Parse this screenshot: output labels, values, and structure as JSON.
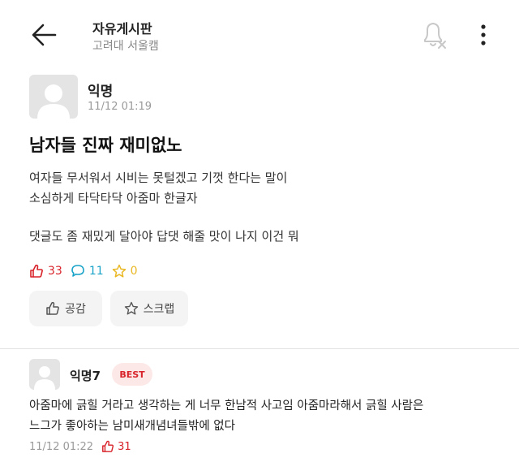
{
  "header": {
    "title": "자유게시판",
    "subtitle": "고려대 서울캠",
    "back_icon": "arrow-left-icon",
    "bell_icon": "bell-off-icon",
    "more_icon": "more-vertical-icon"
  },
  "post": {
    "author": "익명",
    "time": "11/12 01:19",
    "title": "남자들 진짜 재미없노",
    "body_lines": [
      "여자들 무서워서 시비는 못털겠고 기껏 한다는 말이",
      "소심하게 타닥타닥 아줌마 한글자",
      "댓글도 좀 재밌게 달아야 답댓 해줄 맛이 나지 이건 뭐"
    ],
    "stats": {
      "likes": "33",
      "comments": "11",
      "scraps": "0"
    },
    "buttons": {
      "like_label": "공감",
      "scrap_label": "스크랩"
    }
  },
  "comment": {
    "author": "익명7",
    "badge": "BEST",
    "body_lines": [
      "아줌마에 긁힐 거라고 생각하는 게 너무 한남적 사고임 아줌마라해서 긁힐 사람은",
      "느그가 좋아하는 남미새개념녀들밖에 없다"
    ],
    "time": "11/12 01:22",
    "likes": "31"
  },
  "colors": {
    "like_red": "#d8232a",
    "comment_blue": "#1aa3c8",
    "scrap_yellow": "#e9b824",
    "badge_bg": "#fde8e8"
  }
}
